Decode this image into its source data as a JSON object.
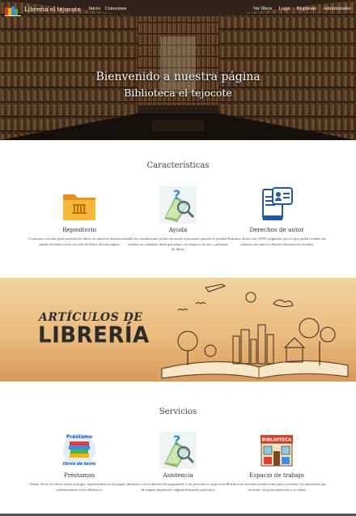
{
  "navbar": {
    "brand": "Libreria el tejocote",
    "links_left": [
      "Inicio",
      "Conocenos"
    ],
    "links_right": [
      "Ver libros",
      "Login",
      "Registrate",
      "Administrador"
    ]
  },
  "hero": {
    "title": "Bienvenido a nuestra página",
    "subtitle": "Biblioteca el tejocote"
  },
  "features": {
    "title": "Características",
    "items": [
      {
        "icon": "folder-icon",
        "title": "Repositorio",
        "desc": "Contamos con una gran variedad de libros en nuestras instalaciones, puede revisarlos en la sección de libros de esta página"
      },
      {
        "icon": "help-icon",
        "title": "Ayuda",
        "desc": "En las instalaciones podrá encontrar a personas quienes le pueden orientar en cualquier duda que tenga con respecto al uso y préstamo de libros"
      },
      {
        "icon": "copyright-book-icon",
        "title": "Derechos de autor",
        "desc": "Nuestros títulos son 100% originales, por lo que podrá resaltar sus trabajos sin temor a obtener información errónea"
      }
    ]
  },
  "banner": {
    "line1": "ARTÍCULOS DE",
    "line2": "LIBRERÍA"
  },
  "services": {
    "title": "Servicios",
    "items": [
      {
        "icon": "loan-icon",
        "title": "Préstamos",
        "desc": "Puede llevar los libros hasta su hogar, registrandose en la página y presentandose en la biblioteca",
        "icon_text1": "Préstamo",
        "icon_text2": "libros de texto"
      },
      {
        "icon": "help-icon",
        "title": "Asistencia",
        "desc": "Sientase con la libertad de preguntarle a las personas a cargo acerca de alguna inquietud o alguna búsqueda particular"
      },
      {
        "icon": "library-building-icon",
        "title": "Espacio de trabajo",
        "desc": "Puede usar nuestras instalaciones para consultar los materiales que necesita, sin preocupaciones y a calma",
        "icon_text1": "BIBLIOTECA"
      }
    ]
  },
  "colors": {
    "navbar_text": "#ffffff",
    "banner_bg": "#e9b97a",
    "folder": "#f5a623",
    "book_blue": "#1f5a9e"
  }
}
